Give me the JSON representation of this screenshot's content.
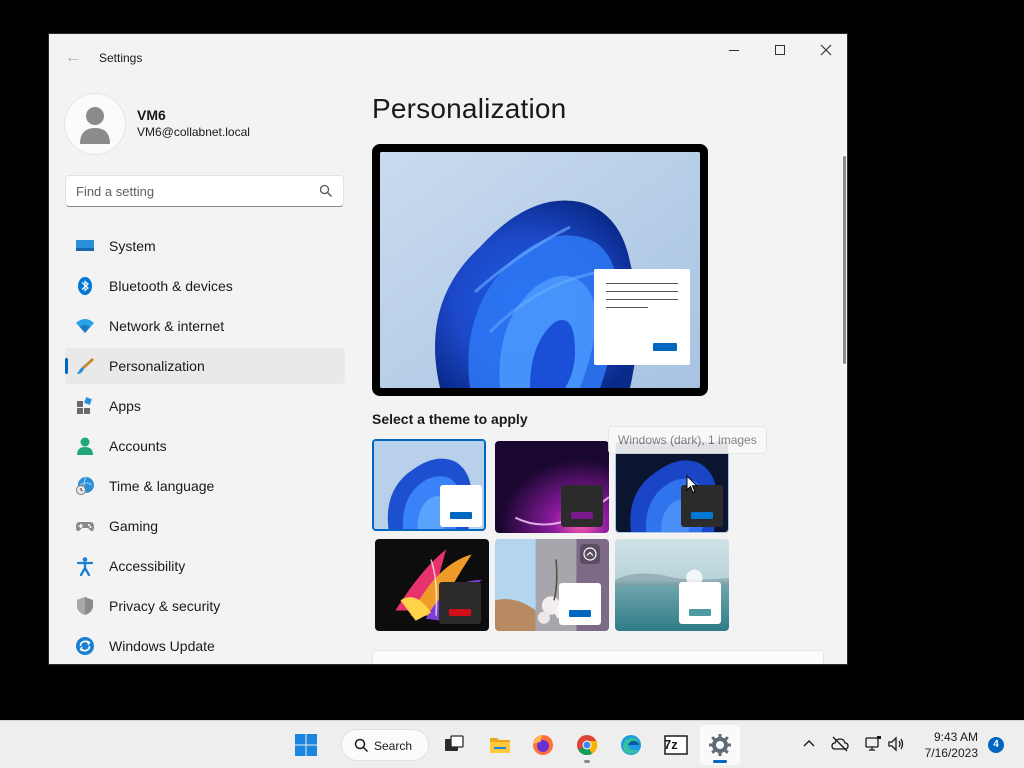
{
  "window": {
    "title": "Settings",
    "back_glyph": "←"
  },
  "profile": {
    "name": "VM6",
    "email": "VM6@collabnet.local"
  },
  "search": {
    "placeholder": "Find a setting"
  },
  "nav": {
    "items": [
      {
        "label": "System",
        "icon": "system-icon"
      },
      {
        "label": "Bluetooth & devices",
        "icon": "bluetooth-icon"
      },
      {
        "label": "Network & internet",
        "icon": "wifi-icon"
      },
      {
        "label": "Personalization",
        "icon": "brush-icon",
        "selected": true
      },
      {
        "label": "Apps",
        "icon": "apps-icon"
      },
      {
        "label": "Accounts",
        "icon": "accounts-icon"
      },
      {
        "label": "Time & language",
        "icon": "time-language-icon"
      },
      {
        "label": "Gaming",
        "icon": "gamepad-icon"
      },
      {
        "label": "Accessibility",
        "icon": "accessibility-icon"
      },
      {
        "label": "Privacy & security",
        "icon": "shield-icon"
      },
      {
        "label": "Windows Update",
        "icon": "windows-update-icon"
      }
    ]
  },
  "main": {
    "title": "Personalization",
    "theme_heading": "Select a theme to apply",
    "tooltip": "Windows (dark), 1 images",
    "themes": [
      {
        "name": "windows-light",
        "selected": true,
        "accent": "#0067c0"
      },
      {
        "name": "glow",
        "accent": "#7a1a8e"
      },
      {
        "name": "windows-dark",
        "accent": "#0078d4"
      },
      {
        "name": "captured-motion",
        "accent": "#d40f1c"
      },
      {
        "name": "flow",
        "accent": "#0067c0"
      },
      {
        "name": "sunrise",
        "accent": "#4d9aa1"
      }
    ]
  },
  "taskbar": {
    "search_label": "Search",
    "time": "9:43 AM",
    "date": "7/16/2023",
    "notification_count": "4",
    "apps": [
      "start-icon",
      "task-view-icon",
      "file-explorer-icon",
      "firefox-icon",
      "chrome-icon",
      "edge-icon",
      "7zip-icon",
      "settings-icon"
    ],
    "zip_label": "7z"
  },
  "colors": {
    "accent": "#0067c0",
    "window_bg": "#f3f3f3",
    "taskbar_bg": "#eeeeee"
  }
}
